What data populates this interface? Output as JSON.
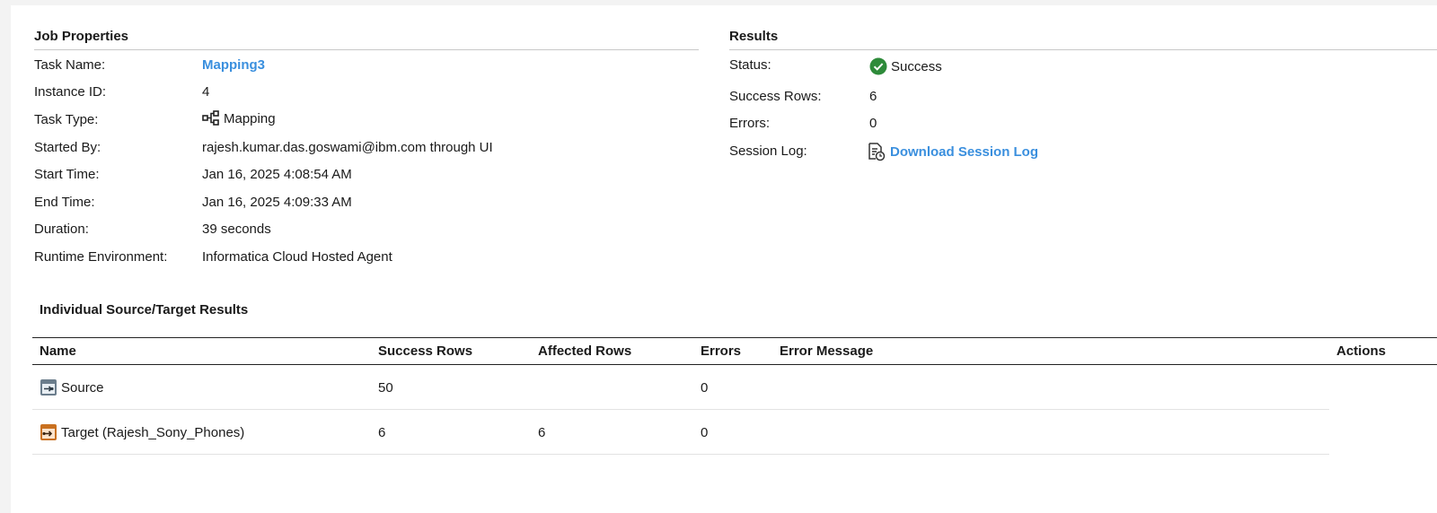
{
  "job_properties": {
    "title": "Job Properties",
    "rows": [
      {
        "label": "Task Name:",
        "value": "Mapping3"
      },
      {
        "label": "Instance ID:",
        "value": "4"
      },
      {
        "label": "Task Type:",
        "value": "Mapping"
      },
      {
        "label": "Started By:",
        "value": "rajesh.kumar.das.goswami@ibm.com through UI"
      },
      {
        "label": "Start Time:",
        "value": "Jan 16, 2025 4:08:54 AM"
      },
      {
        "label": "End Time:",
        "value": "Jan 16, 2025 4:09:33 AM"
      },
      {
        "label": "Duration:",
        "value": "39 seconds"
      },
      {
        "label": "Runtime Environment:",
        "value": "Informatica Cloud Hosted Agent"
      }
    ]
  },
  "results": {
    "title": "Results",
    "status_label": "Status:",
    "status_value": "Success",
    "success_rows_label": "Success Rows:",
    "success_rows_value": "6",
    "errors_label": "Errors:",
    "errors_value": "0",
    "session_log_label": "Session Log:",
    "session_log_link": "Download Session Log"
  },
  "individual": {
    "title": "Individual Source/Target Results",
    "columns": [
      "Name",
      "Success Rows",
      "Affected Rows",
      "Errors",
      "Error Message",
      "Actions"
    ],
    "rows": [
      {
        "name": "Source",
        "icon": "source-icon",
        "success_rows": "50",
        "affected_rows": "",
        "errors": "0",
        "error_message": ""
      },
      {
        "name": "Target (Rajesh_Sony_Phones)",
        "icon": "target-icon",
        "success_rows": "6",
        "affected_rows": "6",
        "errors": "0",
        "error_message": ""
      }
    ]
  },
  "colors": {
    "link": "#3a8fde",
    "success": "#2e8b3a"
  }
}
